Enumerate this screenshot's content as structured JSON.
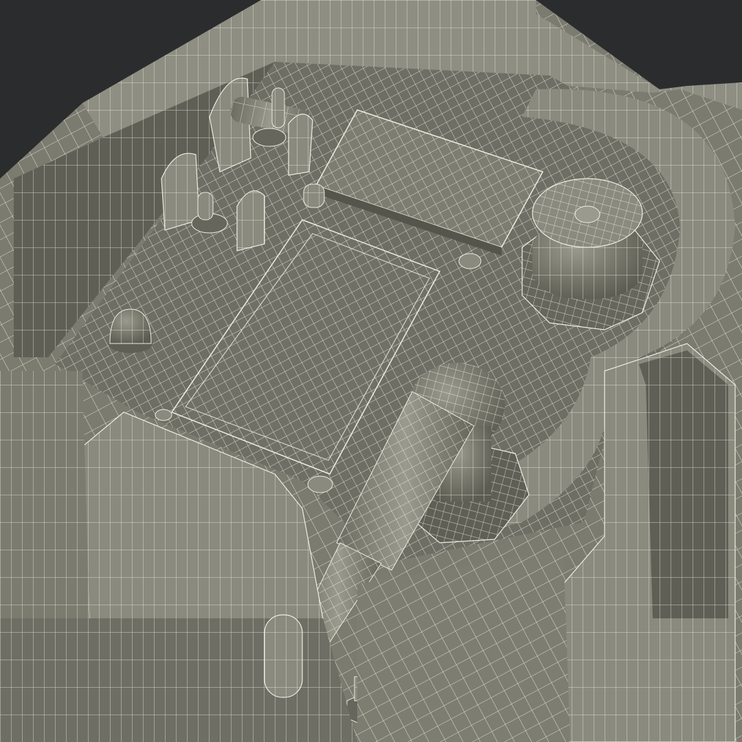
{
  "scene": {
    "subject": "wireframe-render",
    "colors": {
      "background": "#2b2c2e",
      "surface": "#7b7b6f",
      "surface_light": "#8e8e82",
      "surface_dark": "#5f5f55",
      "shadow": "#4a4a42",
      "wire": "#efeee2"
    },
    "parts": [
      "housing",
      "top-rim",
      "back-left-wall",
      "recessed-floor",
      "grid-panel-top",
      "grid-panel-recessed",
      "round-basin",
      "filler-cap",
      "elbow-fitting",
      "spout-pipe",
      "hinge-bracket-upper",
      "hinge-bracket-lower",
      "toggle-switch-upper",
      "toggle-switch-lower",
      "dome-knob",
      "small-post",
      "rivet",
      "bolt-left",
      "bolt-bottom",
      "front-block",
      "right-block"
    ]
  }
}
